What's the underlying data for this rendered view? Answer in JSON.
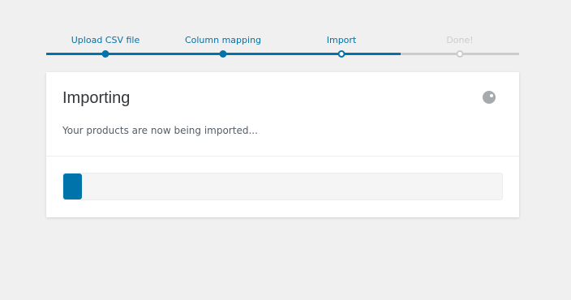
{
  "steps": [
    {
      "label": "Upload CSV file",
      "state": "complete"
    },
    {
      "label": "Column mapping",
      "state": "complete"
    },
    {
      "label": "Import",
      "state": "current"
    },
    {
      "label": "Done!",
      "state": "upcoming"
    }
  ],
  "card": {
    "title": "Importing",
    "description": "Your products are now being imported..."
  },
  "progress": {
    "value": 0.04
  },
  "colors": {
    "accent": "#0073aa",
    "inactive": "#cccccc",
    "background": "#f0f0f0"
  },
  "icons": {
    "spinner": "loading-spinner-icon"
  }
}
